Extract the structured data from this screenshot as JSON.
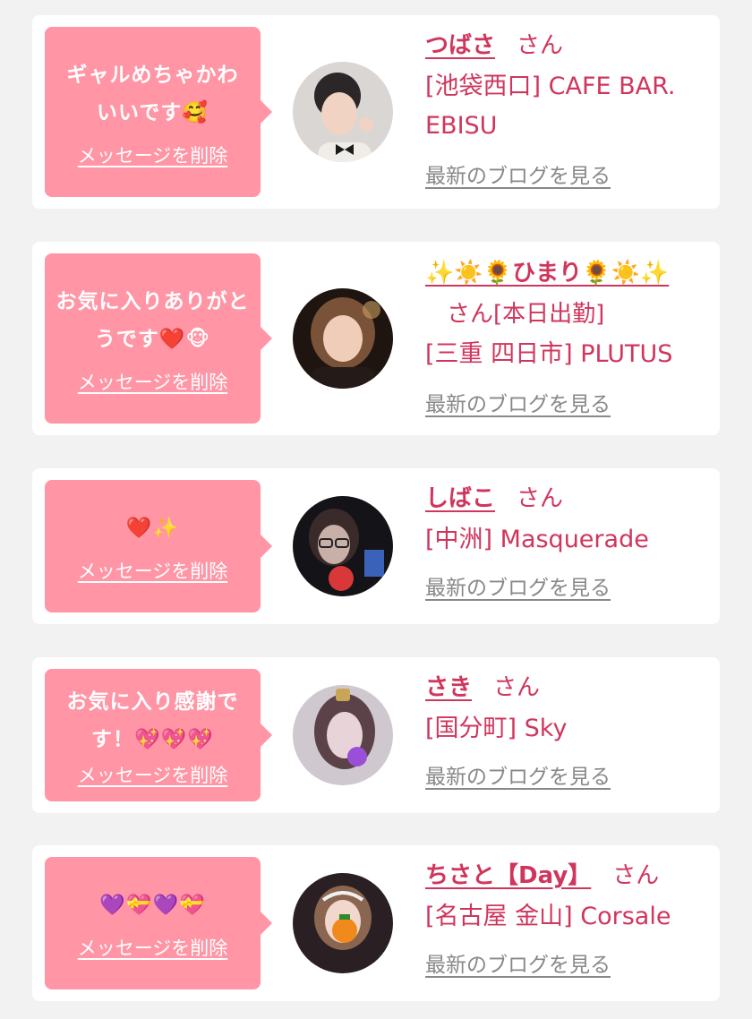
{
  "colors": {
    "background": "#f2f2f2",
    "card": "#ffffff",
    "bubble": "#ff95a5",
    "name_accent": "#d0365d",
    "blog_link": "#888888"
  },
  "delete_label": "メッセージを削除",
  "san_label": "さん",
  "blog_label": "最新のブログを見る",
  "items": [
    {
      "message": "ギャルめちゃかわいいです🥰",
      "name": "つばさ",
      "name_suffix": "",
      "shop": "[池袋西口] CAFE BAR. EBISU",
      "avatar_icon": "girl-avatar-photo"
    },
    {
      "message": "お気に入りありがとうです❤️🐵",
      "name": "✨☀️🌻ひまり🌻☀️✨",
      "name_suffix": "[本日出勤]",
      "shop": "[三重 四日市] PLUTUS",
      "avatar_icon": "girl-avatar-photo"
    },
    {
      "message": "❤️✨",
      "name": "しばこ",
      "name_suffix": "",
      "shop": "[中洲] Masquerade",
      "avatar_icon": "girl-avatar-photo"
    },
    {
      "message": "お気に入り感謝です！💖💖💖",
      "name": "さき",
      "name_suffix": "",
      "shop": "[国分町] Sky",
      "avatar_icon": "girl-avatar-photo"
    },
    {
      "message": "💜💝💜💝",
      "name": "ちさと【Day】",
      "name_suffix": "",
      "shop": "[名古屋 金山] Corsale",
      "avatar_icon": "girl-avatar-photo"
    }
  ]
}
